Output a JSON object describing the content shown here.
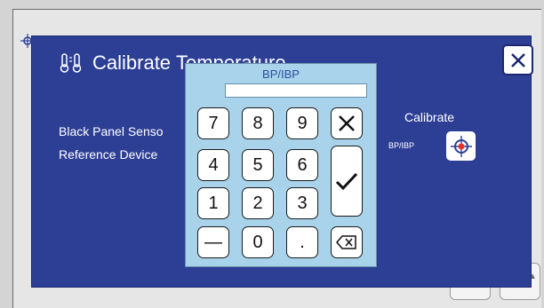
{
  "screen": {
    "title": "Calibrate Temperature",
    "title_visible": "Calibrate",
    "title_partial": "Temperature",
    "labels": {
      "black_panel_sensor": "Black Panel Senso",
      "reference_device": "Reference Device",
      "calibrate": "Calibrate",
      "bp_ibp": "BP/IBP"
    },
    "icons": {
      "title": "thermometer-icon",
      "close": "close-icon",
      "calibrate": "crosshair-icon"
    }
  },
  "keypad": {
    "title": "BP/IBP",
    "value": "",
    "keys": {
      "k7": "7",
      "k8": "8",
      "k9": "9",
      "k4": "4",
      "k5": "5",
      "k6": "6",
      "k1": "1",
      "k2": "2",
      "k3": "3",
      "minus": "—",
      "k0": "0",
      "dot": "."
    },
    "icons": {
      "clear": "cross-icon",
      "enter": "checkmark-icon",
      "backspace": "backspace-icon"
    }
  },
  "colors": {
    "panel": "#2d3f95",
    "keypad": "#a8d3ea",
    "keypad_title": "#2d4fa0",
    "accent_red": "#e2332a"
  }
}
